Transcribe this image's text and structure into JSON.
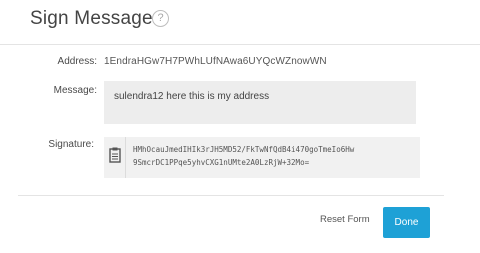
{
  "header": {
    "title": "Sign Message",
    "help_icon": "question-circle-icon",
    "help_glyph": "?"
  },
  "form": {
    "address_label": "Address:",
    "address_value": "1EndraHGw7H7PWhLUfNAwa6UYQcWZnowWN",
    "message_label": "Message:",
    "message_value": "sulendra12 here this is my address",
    "signature_label": "Signature:",
    "signature_icon": "clipboard-icon",
    "signature_line1": "HMhOcauJmedIHIk3rJH5MD52/FkTwNfQdB4i470goTmeIo6Hw",
    "signature_line2": "9SmcrDC1PPqe5yhvCXG1nUMte2A0LzRjW+32Mo="
  },
  "footer": {
    "reset_label": "Reset Form",
    "done_label": "Done"
  },
  "colors": {
    "accent": "#1ea1d6",
    "field_background": "#ededed"
  }
}
